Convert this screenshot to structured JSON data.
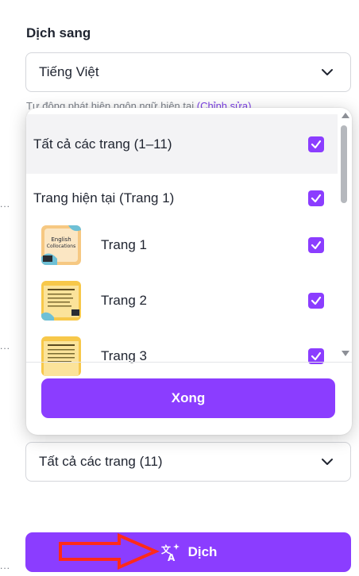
{
  "section_label": "Dịch sang",
  "language_select": {
    "value": "Tiếng Việt",
    "icon": "chevron-down-icon"
  },
  "background_note": {
    "prefix": "Tự động phát hiện ngôn ngữ hiện tại ",
    "link": "(Chỉnh sửa)"
  },
  "edge_dots": "...",
  "page_picker": {
    "all_pages": "Tất cả các trang (1–11)",
    "current_page": "Trang hiện tại (Trang 1)",
    "pages": [
      {
        "label": "Trang 1",
        "thumb_title": "English Collocations",
        "checked": true
      },
      {
        "label": "Trang 2",
        "thumb_title": "",
        "checked": true
      },
      {
        "label": "Trang 3",
        "thumb_title": "",
        "checked": true
      }
    ],
    "done_label": "Xong"
  },
  "pages_select": {
    "value": "Tất cả các trang (11)",
    "icon": "chevron-down-icon"
  },
  "translate_button": {
    "label": "Dịch",
    "icon": "translate-sparkle-icon"
  },
  "colors": {
    "accent": "#8b3dff",
    "arrow": "#ff2a1a"
  }
}
